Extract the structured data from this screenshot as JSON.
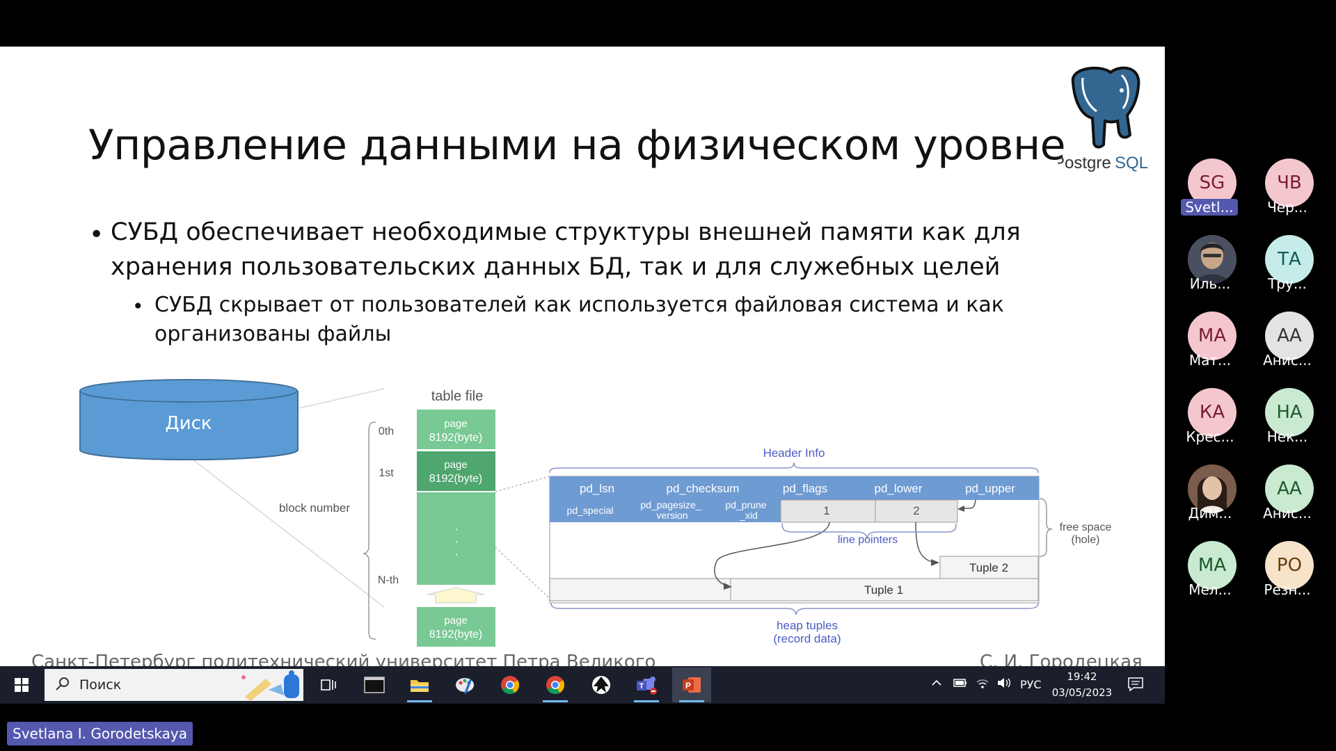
{
  "slide": {
    "title": "Управление данными на физическом уровне",
    "bullet1_line1": "СУБД обеспечивает необходимые структуры внешней памяти как для",
    "bullet1_line2": "хранения пользовательских данных БД,  так и для служебных целей",
    "bullet2_line1": "СУБД скрывает от пользователей как используется файловая система и как",
    "bullet2_line2": "организованы файлы",
    "logo_text_a": "Postgre",
    "logo_text_b": "SQL",
    "footer_left": "Санкт-Петербург политехнический университет Петра Великого",
    "footer_right": "С. И. Городецкая"
  },
  "diagram": {
    "disk_label": "Диск",
    "table_file_label": "table file",
    "block_number_label": "block number",
    "block_labels": [
      "0th",
      "1st",
      "N-th"
    ],
    "page_label": "page",
    "page_size": "8192(byte)",
    "header_info": "Header Info",
    "header_fields_row1": [
      "pd_lsn",
      "pd_checksum",
      "pd_flags",
      "pd_lower",
      "pd_upper"
    ],
    "header_fields_row2": [
      "pd_special",
      "pd_pagesize_",
      "version",
      "pd_prune",
      "_xid"
    ],
    "line_pointer_values": [
      "1",
      "2"
    ],
    "line_pointers_label": "line pointers",
    "free_space_label": "free space",
    "free_space_sub": "(hole)",
    "tuple2": "Tuple 2",
    "tuple1": "Tuple 1",
    "heap_tuples": "heap tuples",
    "heap_tuples_sub": "(record data)"
  },
  "participants": [
    {
      "initials": "SG",
      "name": "Svetl...",
      "bg": "#f4c7cf",
      "fg": "#7a1d2e",
      "active": true
    },
    {
      "initials": "ЧВ",
      "name": "Чер...",
      "bg": "#f4c7cf",
      "fg": "#7a1d2e",
      "active": false
    },
    {
      "initials": "",
      "name": "Иль...",
      "bg": "#6a6f80",
      "fg": "#fff",
      "active": false,
      "photo": true
    },
    {
      "initials": "ТА",
      "name": "Тру...",
      "bg": "#c6ecea",
      "fg": "#0b5b57",
      "active": false
    },
    {
      "initials": "МА",
      "name": "Мат...",
      "bg": "#f4c7cf",
      "fg": "#7a1d2e",
      "active": false
    },
    {
      "initials": "АА",
      "name": "Анис...",
      "bg": "#e3e3e3",
      "fg": "#333",
      "active": false
    },
    {
      "initials": "КА",
      "name": "Крес...",
      "bg": "#f4c7cf",
      "fg": "#7a1d2e",
      "active": false
    },
    {
      "initials": "НА",
      "name": "Нек...",
      "bg": "#c9ead1",
      "fg": "#1f5a2d",
      "active": false
    },
    {
      "initials": "",
      "name": "Дим...",
      "bg": "#8a6a58",
      "fg": "#fff",
      "active": false,
      "photo": true
    },
    {
      "initials": "АА",
      "name": "Анис...",
      "bg": "#c9ead1",
      "fg": "#1f5a2d",
      "active": false
    },
    {
      "initials": "МА",
      "name": "Мел...",
      "bg": "#c9ead1",
      "fg": "#1f5a2d",
      "active": false
    },
    {
      "initials": "РО",
      "name": "Резн...",
      "bg": "#f6e3c9",
      "fg": "#6b3d0d",
      "active": false
    }
  ],
  "taskbar": {
    "search_placeholder": "Поиск",
    "apps": [
      "task-view",
      "terminal",
      "file-explorer",
      "paint",
      "chrome",
      "chrome-2",
      "inkscape",
      "teams",
      "powerpoint"
    ],
    "language": "РУС",
    "time": "19:42",
    "date": "03/05/2023"
  },
  "presenter_name": "Svetlana I. Gorodetskaya"
}
